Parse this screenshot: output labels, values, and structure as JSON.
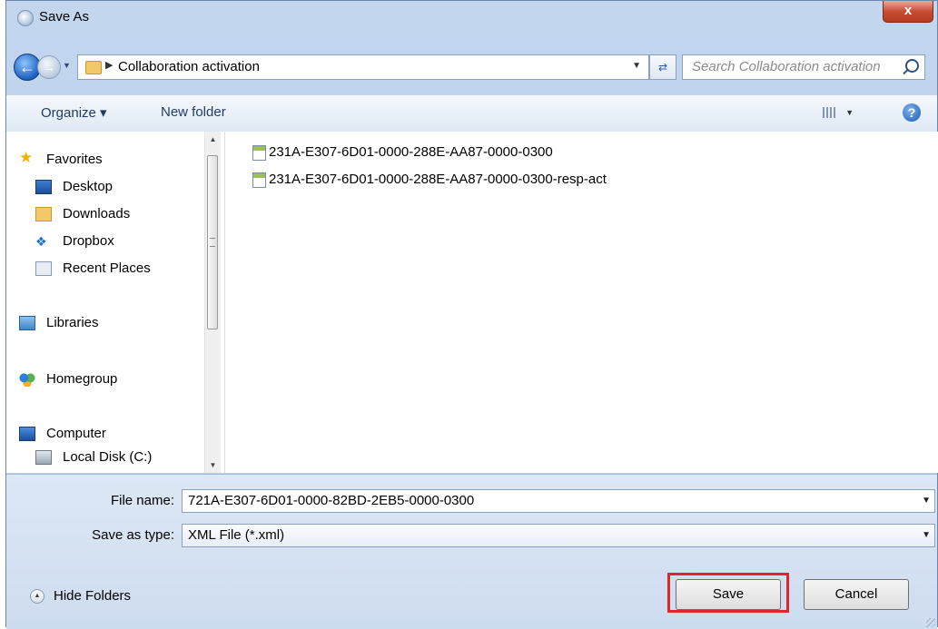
{
  "window": {
    "title": "Save As",
    "close_label": "x"
  },
  "address": {
    "path": "Collaboration activation",
    "search_placeholder": "Search Collaboration activation"
  },
  "toolbar": {
    "organize": "Organize ▾",
    "new_folder": "New folder"
  },
  "sidebar": {
    "favorites": "Favorites",
    "desktop": "Desktop",
    "downloads": "Downloads",
    "dropbox": "Dropbox",
    "recent_places": "Recent Places",
    "libraries": "Libraries",
    "homegroup": "Homegroup",
    "computer": "Computer",
    "local_disk": "Local Disk (C:)"
  },
  "files": [
    "231A-E307-6D01-0000-288E-AA87-0000-0300",
    "231A-E307-6D01-0000-288E-AA87-0000-0300-resp-act"
  ],
  "form": {
    "file_name_label": "File name:",
    "file_name_value": "721A-E307-6D01-0000-82BD-2EB5-0000-0300",
    "save_type_label": "Save as type:",
    "save_type_value": "XML File (*.xml)"
  },
  "footer": {
    "hide_folders": "Hide Folders",
    "save": "Save",
    "cancel": "Cancel"
  },
  "colors": {
    "highlight": "#e0252d",
    "chrome": "#b4cbe8"
  }
}
